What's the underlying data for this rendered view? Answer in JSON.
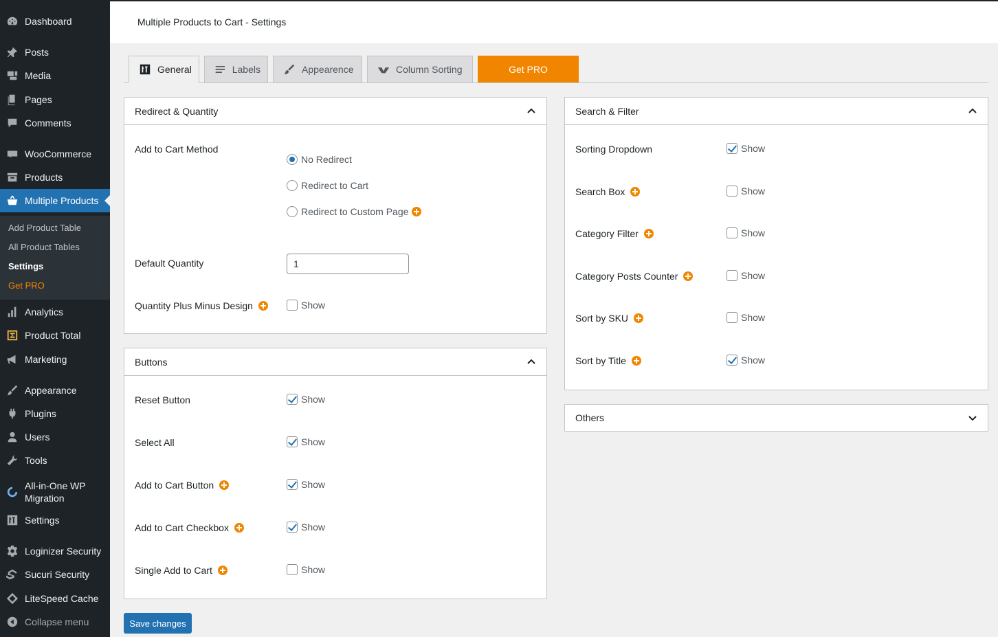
{
  "sidebar": {
    "items": [
      {
        "label": "Dashboard",
        "icon": "dashboard-icon"
      },
      {
        "label": "Posts",
        "icon": "pin-icon"
      },
      {
        "label": "Media",
        "icon": "media-icon"
      },
      {
        "label": "Pages",
        "icon": "pages-icon"
      },
      {
        "label": "Comments",
        "icon": "comment-icon"
      },
      {
        "label": "WooCommerce",
        "icon": "woo-icon"
      },
      {
        "label": "Products",
        "icon": "archive-icon"
      },
      {
        "label": "Multiple Products",
        "icon": "basket-icon",
        "active": true
      },
      {
        "label": "Analytics",
        "icon": "bar-chart-icon"
      },
      {
        "label": "Product Total",
        "icon": "sigma-icon"
      },
      {
        "label": "Marketing",
        "icon": "megaphone-icon"
      },
      {
        "label": "Appearance",
        "icon": "brush-icon"
      },
      {
        "label": "Plugins",
        "icon": "plug-icon"
      },
      {
        "label": "Users",
        "icon": "user-icon"
      },
      {
        "label": "Tools",
        "icon": "wrench-icon"
      },
      {
        "label": "All-in-One WP Migration",
        "icon": "migration-icon"
      },
      {
        "label": "Settings",
        "icon": "sliders-icon"
      },
      {
        "label": "Loginizer Security",
        "icon": "gear-icon"
      },
      {
        "label": "Sucuri Security",
        "icon": "sucuri-icon"
      },
      {
        "label": "LiteSpeed Cache",
        "icon": "diamond-icon"
      }
    ],
    "submenu": [
      {
        "label": "Add Product Table"
      },
      {
        "label": "All Product Tables"
      },
      {
        "label": "Settings",
        "current": true
      },
      {
        "label": "Get PRO",
        "pro": true
      }
    ],
    "collapse_label": "Collapse menu"
  },
  "header": {
    "title": "Multiple Products to Cart - Settings"
  },
  "tabs": [
    {
      "label": "General",
      "icon": "sliders-icon",
      "active": true
    },
    {
      "label": "Labels",
      "icon": "text-lines-icon"
    },
    {
      "label": "Appearence",
      "icon": "brush-icon"
    },
    {
      "label": "Column Sorting",
      "icon": "sort-icon"
    },
    {
      "label": "Get PRO"
    }
  ],
  "redirect_panel": {
    "title": "Redirect & Quantity",
    "method_label": "Add to Cart Method",
    "options": [
      {
        "label": "No Redirect",
        "checked": true
      },
      {
        "label": "Redirect to Cart",
        "checked": false
      },
      {
        "label": "Redirect to Custom Page",
        "checked": false,
        "pro": true
      }
    ],
    "default_qty_label": "Default Quantity",
    "default_qty_value": "1",
    "plus_minus_label": "Quantity Plus Minus Design",
    "plus_minus_show": "Show"
  },
  "buttons_panel": {
    "title": "Buttons",
    "rows": [
      {
        "label": "Reset Button",
        "show": "Show",
        "checked": true,
        "pro": false
      },
      {
        "label": "Select All",
        "show": "Show",
        "checked": true,
        "pro": false
      },
      {
        "label": "Add to Cart Button",
        "show": "Show",
        "checked": true,
        "pro": true
      },
      {
        "label": "Add to Cart Checkbox",
        "show": "Show",
        "checked": true,
        "pro": true
      },
      {
        "label": "Single Add to Cart",
        "show": "Show",
        "checked": false,
        "pro": true
      }
    ]
  },
  "search_panel": {
    "title": "Search & Filter",
    "rows": [
      {
        "label": "Sorting Dropdown",
        "show": "Show",
        "checked": true,
        "pro": false
      },
      {
        "label": "Search Box",
        "show": "Show",
        "checked": false,
        "pro": true
      },
      {
        "label": "Category Filter",
        "show": "Show",
        "checked": false,
        "pro": true
      },
      {
        "label": "Category Posts Counter",
        "show": "Show",
        "checked": false,
        "pro": true
      },
      {
        "label": "Sort by SKU",
        "show": "Show",
        "checked": false,
        "pro": true
      },
      {
        "label": "Sort by Title",
        "show": "Show",
        "checked": true,
        "pro": true
      }
    ]
  },
  "others_panel": {
    "title": "Others"
  },
  "save_label": "Save changes",
  "colors": {
    "accent": "#2271b1",
    "pro": "#f18500",
    "sidebar": "#1d2327"
  }
}
